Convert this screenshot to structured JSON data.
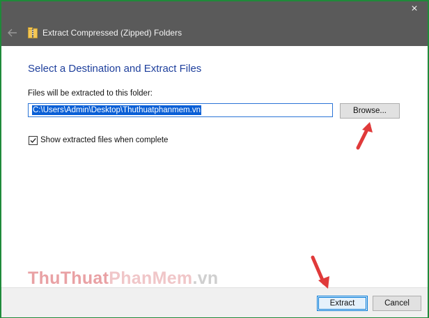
{
  "window": {
    "title": "Extract Compressed (Zipped) Folders",
    "close_glyph": "×"
  },
  "main": {
    "heading": "Select a Destination and Extract Files",
    "field_label": "Files will be extracted to this folder:",
    "path_value": "C:\\Users\\Admin\\Desktop\\Thuthuatphanmem.vn",
    "browse_label": "Browse...",
    "show_files_label": "Show extracted files when complete",
    "show_files_checked": true
  },
  "footer": {
    "extract_label": "Extract",
    "cancel_label": "Cancel"
  },
  "watermark": {
    "part1": "ThuThuat",
    "part2": "PhanMem",
    "part3": ".vn"
  },
  "colors": {
    "titlebar": "#5a5a5a",
    "heading": "#1e3f9c",
    "selection": "#0a5fd6",
    "arrow": "#e03a3a",
    "frame_border": "#1f8a3a"
  },
  "icons": {
    "back": "left-arrow-icon",
    "zip": "zip-folder-icon",
    "close": "close-icon",
    "check": "checkmark-icon"
  }
}
